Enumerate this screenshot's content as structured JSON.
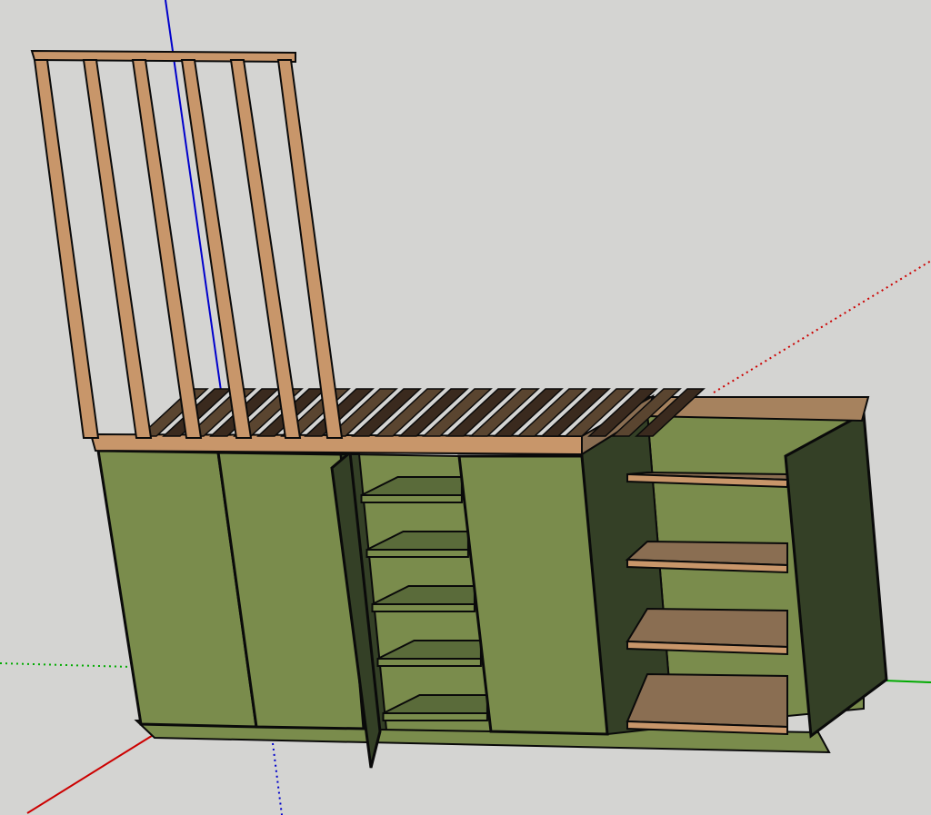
{
  "viewport": {
    "background": "#d4d4d2",
    "axes": {
      "x_color": "#cc0000",
      "y_color": "#00aa00",
      "z_color": "#0000cc"
    }
  },
  "model": {
    "cabinet_color": "#7a8c4c",
    "cabinet_dark": "#344026",
    "cabinet_mid": "#5a6b3a",
    "wood_color": "#c8966a",
    "shelf_color": "#8a6e52",
    "slat_dark": "#3a2a1e",
    "edge_color": "#0a0a0a"
  }
}
